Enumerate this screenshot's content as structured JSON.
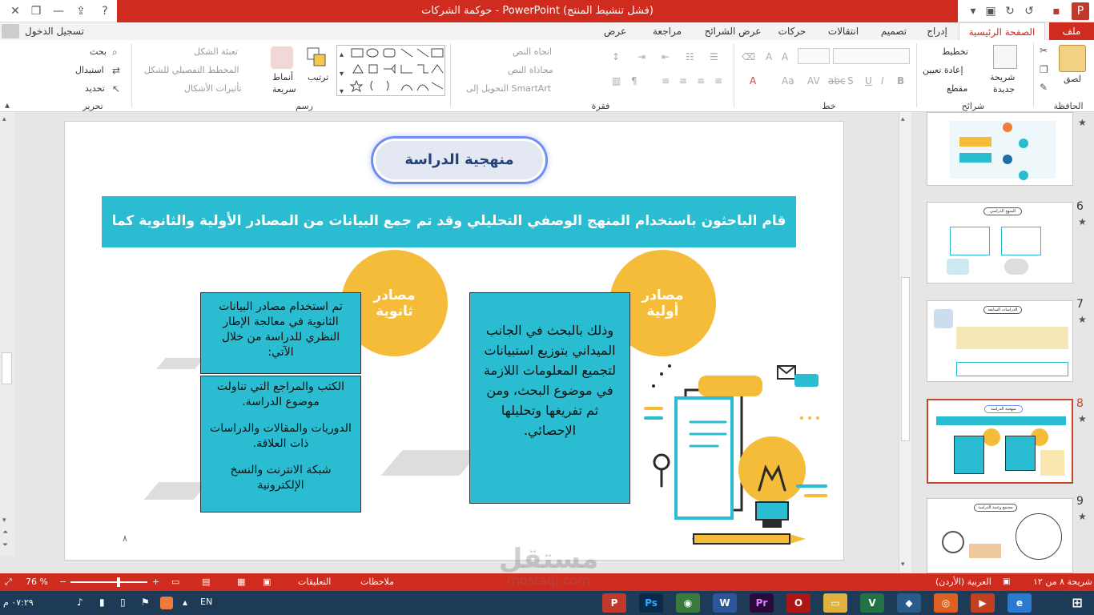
{
  "window": {
    "title": "حوكمة الشركات  -  PowerPoint (فشل تنشيط المنتج)",
    "sign_in": "تسجيل الدخول"
  },
  "tabs": [
    "ملف",
    "الصفحة الرئيسية",
    "إدراج",
    "تصميم",
    "انتقالات",
    "حركات",
    "عرض الشرائح",
    "مراجعة",
    "عرض"
  ],
  "ribbon": {
    "clipboard": {
      "label": "الحافظة",
      "paste": "لصق"
    },
    "slides": {
      "label": "شرائح",
      "new_slide": "شريحة",
      "new_slide2": "جديدة",
      "layout": "تخطيط",
      "reset": "إعادة تعيين",
      "section": "مقطع"
    },
    "font": {
      "label": "خط"
    },
    "paragraph": {
      "label": "فقرة",
      "text_direction": "اتجاه النص",
      "align_text": "محاذاة النص",
      "smartart": "التحويل إلى SmartArt"
    },
    "drawing": {
      "label": "رسم",
      "arrange": "ترتيب",
      "quick_styles": "أنماط",
      "quick_styles2": "سريعة",
      "shape_fill": "تعبئة الشكل",
      "shape_outline": "المخطط التفصيلي للشكل",
      "shape_effects": "تأثيرات الأشكال"
    },
    "editing": {
      "label": "تحرير",
      "find": "بحث",
      "replace": "استبدال",
      "select": "تحديد"
    }
  },
  "slide": {
    "title": "منهجية الدراسة",
    "banner": "قام الباحثون باستخدام المنهج الوصفي التحليلي وقد تم جمع البيانات من المصادر الأولية والثانوية كما يلي:",
    "primary_circle": "مصادر أولية",
    "secondary_circle": "مصادر ثانوية",
    "primary_text": "وذلك بالبحث في الجانب الميداني بتوزيع استبيانات لتجميع المعلومات اللازمة في موضوع البحث، ومن ثم تفريغها وتحليلها الإحصائي.",
    "secondary_intro": "تم استخدام مصادر البيانات الثانوية في معالجة الإطار النظري للدراسة من خلال الآتي:",
    "secondary_items": [
      "الكتب والمراجع التي تناولت موضوع الدراسة.",
      "الدوريات والمقالات والدراسات ذات العلاقة.",
      "شبكة الانترنت والنسخ الإلكترونية"
    ],
    "page_number": "٨"
  },
  "thumbnails": [
    {
      "number": "",
      "title": ""
    },
    {
      "number": "6",
      "title": "المنهج الدراسي"
    },
    {
      "number": "7",
      "title": "الدراسات السابقة"
    },
    {
      "number": "8",
      "title": "منهجية الدراسة"
    },
    {
      "number": "9",
      "title": "مجتمع وعينة الدراسة"
    }
  ],
  "status": {
    "slide_of": "شريحة ٨ من ١٢",
    "language": "العربية (الأردن)",
    "notes": "ملاحظات",
    "comments": "التعليقات",
    "zoom": "76 %"
  },
  "taskbar": {
    "time": "٠٧:٢٩ م",
    "lang": "EN"
  },
  "watermark": {
    "text": "مستقل",
    "url": "mostaql.com"
  },
  "colors": {
    "accent": "#d02b1f",
    "teal": "#2abcd0",
    "yellow": "#f5bc3a",
    "title_text": "#23427a"
  }
}
